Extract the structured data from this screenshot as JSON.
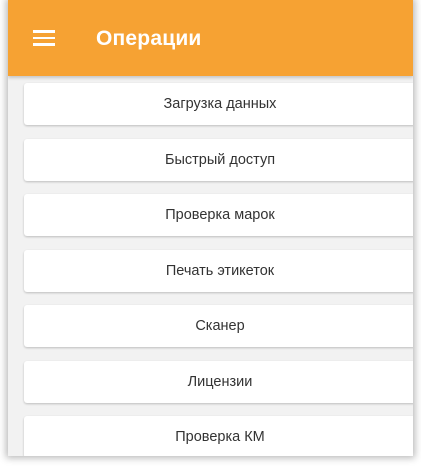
{
  "appbar": {
    "title": "Операции",
    "color": "#f6a233",
    "menu_icon": "hamburger-menu-icon"
  },
  "operations": [
    {
      "label": "Загрузка данных"
    },
    {
      "label": "Быстрый доступ"
    },
    {
      "label": "Проверка марок"
    },
    {
      "label": "Печать этикеток"
    },
    {
      "label": "Сканер"
    },
    {
      "label": "Лицензии"
    },
    {
      "label": "Проверка КМ"
    }
  ]
}
